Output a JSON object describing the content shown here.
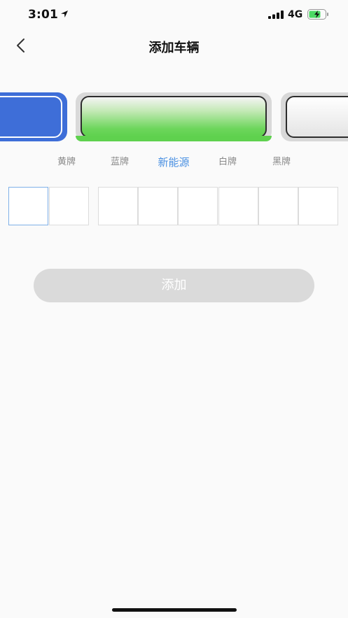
{
  "status_bar": {
    "time": "3:01",
    "network": "4G"
  },
  "nav": {
    "title": "添加车辆"
  },
  "plate_types": [
    {
      "label": "黄牌",
      "active": false
    },
    {
      "label": "蓝牌",
      "active": false
    },
    {
      "label": "新能源",
      "active": true
    },
    {
      "label": "白牌",
      "active": false
    },
    {
      "label": "黑牌",
      "active": false
    }
  ],
  "plate_input": {
    "cells": [
      "",
      "",
      "",
      "",
      "",
      "",
      "",
      ""
    ],
    "active_index": 0
  },
  "add_button": {
    "label": "添加",
    "disabled": true
  },
  "colors": {
    "accent": "#4a90e2",
    "plate_blue": "#3e6ed8",
    "plate_green": "#5fd14e",
    "button_disabled": "#dadada"
  }
}
